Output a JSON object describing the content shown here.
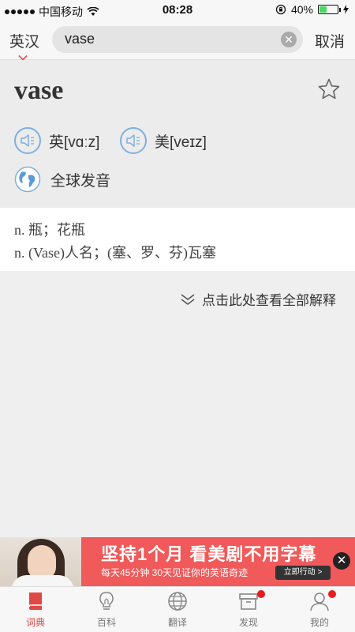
{
  "status_bar": {
    "carrier": "中国移动",
    "time": "08:28",
    "battery": "40%",
    "battery_level": 0.4
  },
  "header": {
    "lang_label": "英汉",
    "search_value": "vase",
    "cancel_label": "取消"
  },
  "entry": {
    "word": "vase",
    "uk_label": "英",
    "uk_phonetic": "[vɑːz]",
    "us_label": "美",
    "us_phonetic": "[veɪz]",
    "global_label": "全球发音",
    "definitions": [
      "n. 瓶；花瓶",
      "n. (Vase)人名；(塞、罗、芬)瓦塞"
    ],
    "more_label": "点击此处查看全部解释"
  },
  "ad": {
    "title": "坚持1个月  看美剧不用字幕",
    "subtitle": "每天45分钟  30天见证你的英语奇迹",
    "button": "立即行动 >"
  },
  "tabs": [
    {
      "label": "词典",
      "icon": "book-icon",
      "active": true
    },
    {
      "label": "百科",
      "icon": "lightbulb-icon",
      "active": false
    },
    {
      "label": "翻译",
      "icon": "globe-icon",
      "active": false
    },
    {
      "label": "发现",
      "icon": "box-icon",
      "active": false,
      "badge": true
    },
    {
      "label": "我的",
      "icon": "person-icon",
      "active": false,
      "badge": true
    }
  ],
  "colors": {
    "accent": "#e04848",
    "ad_background": "#f05a5a",
    "speaker_blue": "#7fb0dc"
  }
}
